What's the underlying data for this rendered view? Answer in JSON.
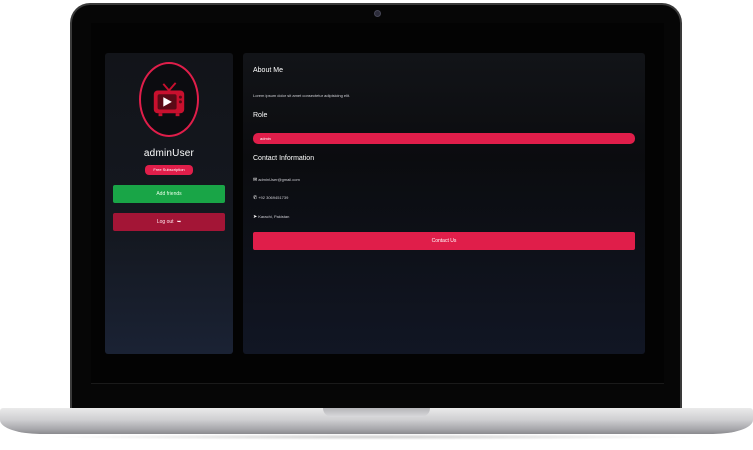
{
  "profile": {
    "username": "adminUser",
    "subscription_label": "Free Subscription",
    "add_friends_label": "Add friends",
    "logout_label": "Log out",
    "logout_icon": "logout-icon"
  },
  "about": {
    "heading": "About Me",
    "text": "Lorem ipsum dolor sit amet consectetur adipisicing elit."
  },
  "role": {
    "heading": "Role",
    "value": "admin"
  },
  "contact": {
    "heading": "Contact Information",
    "email": "adminUser@gmail.com",
    "phone": "+92 3069451739",
    "location": "Karachi, Pakistan",
    "button_label": "Contact Us",
    "icons": [
      "envelope-icon",
      "phone-icon",
      "location-arrow-icon"
    ]
  },
  "colors": {
    "accent": "#e01e4a",
    "success": "#19a547",
    "danger": "#a31536",
    "panel": "#141820",
    "screen": "#030303"
  }
}
